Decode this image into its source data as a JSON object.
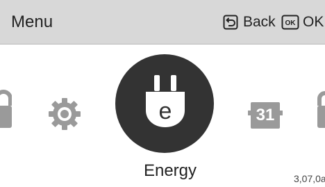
{
  "header": {
    "title": "Menu",
    "back_label": "Back",
    "ok_label": "OK",
    "ok_icon_text": "OK"
  },
  "carousel": {
    "selected_label": "Energy",
    "calendar_number": "31",
    "energy_icon_letter": "e",
    "items": [
      "lock-icon",
      "gear-icon",
      "energy-plug-icon",
      "calendar-icon",
      "lock-icon"
    ]
  },
  "footer": {
    "version": "3,07,0a"
  },
  "colors": {
    "header_bg": "#d8d8d8",
    "icon_dark": "#333333",
    "text": "#222222",
    "screen_bg": "#ffffff"
  }
}
